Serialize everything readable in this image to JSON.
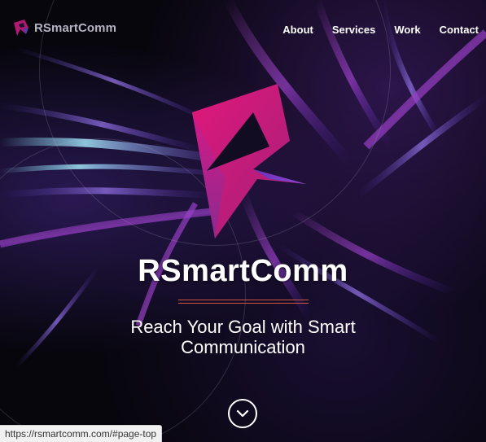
{
  "nav": {
    "brand": "RSmartComm",
    "links": [
      "About",
      "Services",
      "Work",
      "Contact"
    ]
  },
  "hero": {
    "title": "RSmartComm",
    "tagline_line1": "Reach Your Goal with Smart",
    "tagline_line2": "Communication",
    "scroll_icon": "chevron-down-icon"
  },
  "status_bar": {
    "url": "https://rsmartcomm.com/#page-top"
  },
  "colors": {
    "accent_pink": "#d8177f",
    "accent_purple": "#6b3bb8",
    "divider": "#d1583e",
    "background": "#07060d"
  }
}
